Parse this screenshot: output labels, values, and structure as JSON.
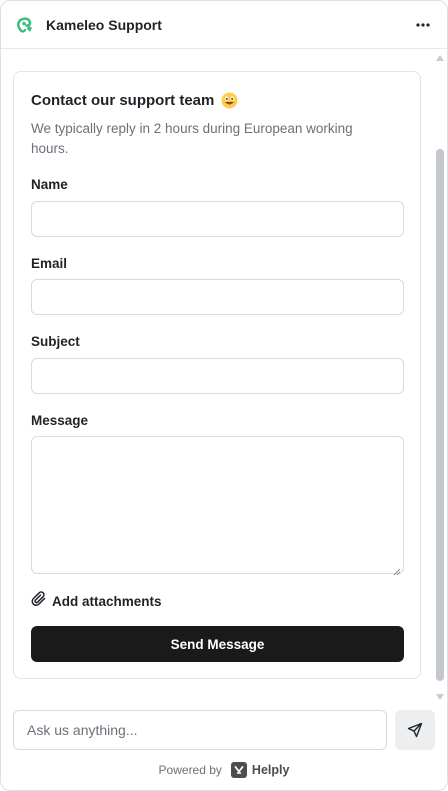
{
  "header": {
    "title": "Kameleo Support",
    "logo_icon": "kameleo-chameleon-icon",
    "more_icon": "more-horizontal-icon",
    "accent_color": "#3fbf7f"
  },
  "form": {
    "title": "Contact our support team",
    "title_emoji": "grinning-face-with-tongue-emoji",
    "subtitle": "We typically reply in 2 hours during European working hours.",
    "fields": {
      "name": {
        "label": "Name",
        "value": ""
      },
      "email": {
        "label": "Email",
        "value": ""
      },
      "subject": {
        "label": "Subject",
        "value": ""
      },
      "message": {
        "label": "Message",
        "value": ""
      }
    },
    "attachments_label": "Add attachments",
    "attachments_icon": "paperclip-icon",
    "submit_label": "Send Message",
    "submit_color": "#1a1a1a"
  },
  "composer": {
    "placeholder": "Ask us anything...",
    "send_icon": "paper-plane-icon"
  },
  "footer": {
    "powered_by": "Powered by",
    "brand": "Helply"
  }
}
